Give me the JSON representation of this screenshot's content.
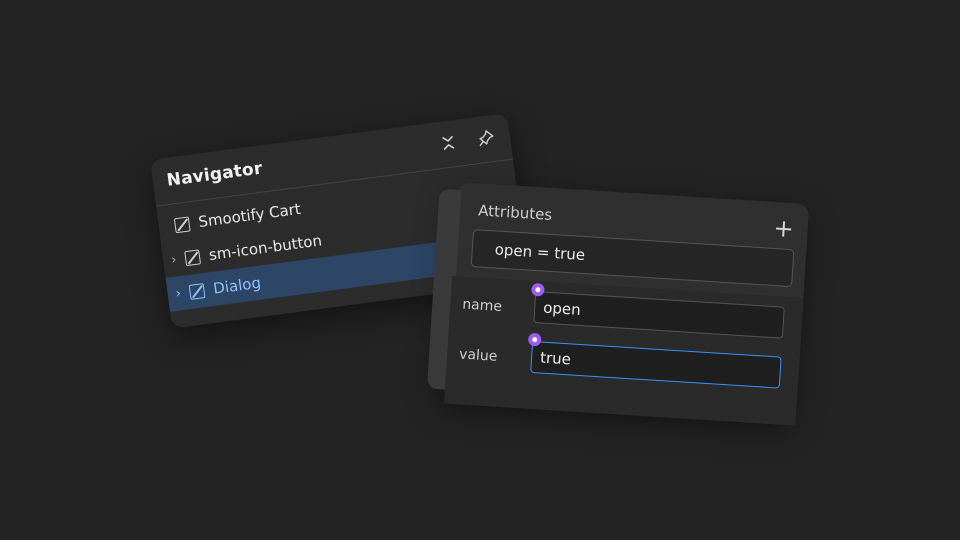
{
  "navigator": {
    "title": "Navigator",
    "icons": [
      "collapse-icon",
      "pin-icon"
    ],
    "items": [
      {
        "label": "Smootify Cart",
        "has_chevron": false,
        "selected": false,
        "icon": "element-box-icon"
      },
      {
        "label": "sm-icon-button",
        "has_chevron": true,
        "selected": false,
        "icon": "element-box-icon"
      },
      {
        "label": "Dialog",
        "has_chevron": true,
        "selected": true,
        "icon": "element-box-icon"
      }
    ]
  },
  "attributes": {
    "title": "Attributes",
    "add_icon": "plus-icon",
    "entry": "open = true",
    "name_label": "name",
    "name_value": "open",
    "value_label": "value",
    "value_value": "true"
  },
  "colors": {
    "background": "#232323",
    "selected_row": "#2d4666",
    "selected_text": "#8fc0ff",
    "focus_border": "#3d8eff",
    "cursor_marker": "#9c5cf5"
  }
}
